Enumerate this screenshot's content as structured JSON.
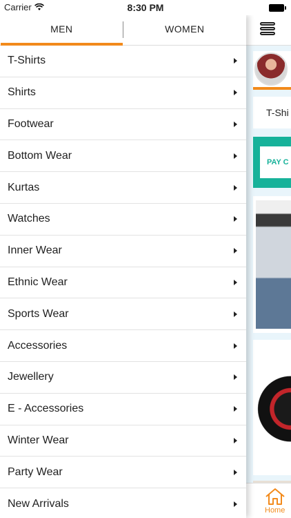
{
  "status_bar": {
    "carrier": "Carrier",
    "time": "8:30 PM"
  },
  "drawer": {
    "tabs": [
      {
        "label": "MEN",
        "selected": true
      },
      {
        "label": "WOMEN",
        "selected": false
      }
    ],
    "categories": [
      "T-Shirts",
      "Shirts",
      "Footwear",
      "Bottom Wear",
      "Kurtas",
      "Watches",
      "Inner Wear",
      "Ethnic Wear",
      "Sports Wear",
      "Accessories",
      "Jewellery",
      "E - Accessories",
      "Winter Wear",
      "Party Wear",
      "New Arrivals"
    ]
  },
  "main": {
    "chip_label": "T-Shi",
    "banner_text": "PAY C",
    "bottom_nav": {
      "home_label": "Home"
    }
  },
  "colors": {
    "accent": "#f28a1b",
    "banner": "#17b29a"
  }
}
